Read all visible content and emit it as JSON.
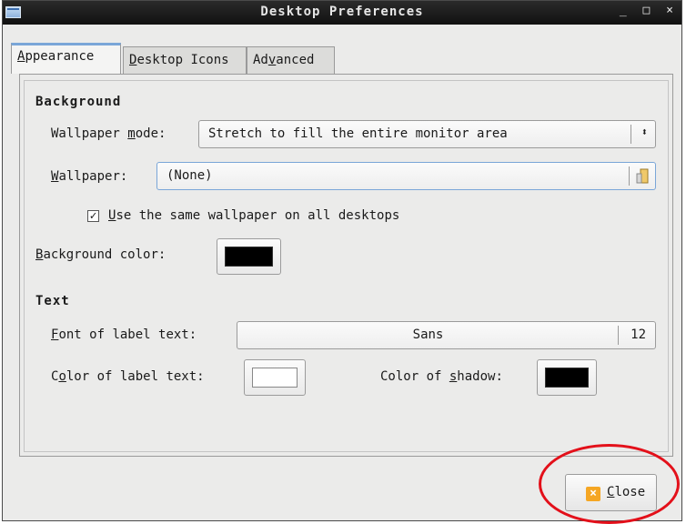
{
  "window": {
    "title": "Desktop Preferences",
    "controls": [
      "_",
      "□",
      "×"
    ]
  },
  "tabs": [
    {
      "label_mnemonic": "A",
      "label_rest": "ppearance"
    },
    {
      "label_mnemonic": "D",
      "label_rest": "esktop Icons"
    },
    {
      "label_pre": "Ad",
      "label_mnemonic": "v",
      "label_rest": "anced"
    }
  ],
  "background": {
    "heading": "Background",
    "wallpaper_mode": {
      "label_pre": "Wallpaper ",
      "label_mnemonic": "m",
      "label_rest": "ode:",
      "value": "Stretch to fill the entire monitor area"
    },
    "wallpaper": {
      "label_mnemonic": "W",
      "label_rest": "allpaper:",
      "value": "(None)"
    },
    "same_wallpaper": {
      "checked_glyph": "✓",
      "label_mnemonic": "U",
      "label_rest": "se the same wallpaper on all desktops"
    },
    "bg_color": {
      "label_mnemonic": "B",
      "label_rest": "ackground color:",
      "color": "#000000"
    }
  },
  "text": {
    "heading": "Text",
    "font": {
      "label_mnemonic": "F",
      "label_rest": "ont of label text:",
      "name": "Sans",
      "size": "12"
    },
    "label_color": {
      "label_pre": "C",
      "label_mnemonic": "o",
      "label_rest": "lor of label text:",
      "color": "#ffffff"
    },
    "shadow_color": {
      "label_pre": "Color of ",
      "label_mnemonic": "s",
      "label_rest": "hadow:",
      "color": "#000000"
    }
  },
  "close_button": {
    "label_mnemonic": "C",
    "label_rest": "lose",
    "icon_glyph": "×"
  }
}
